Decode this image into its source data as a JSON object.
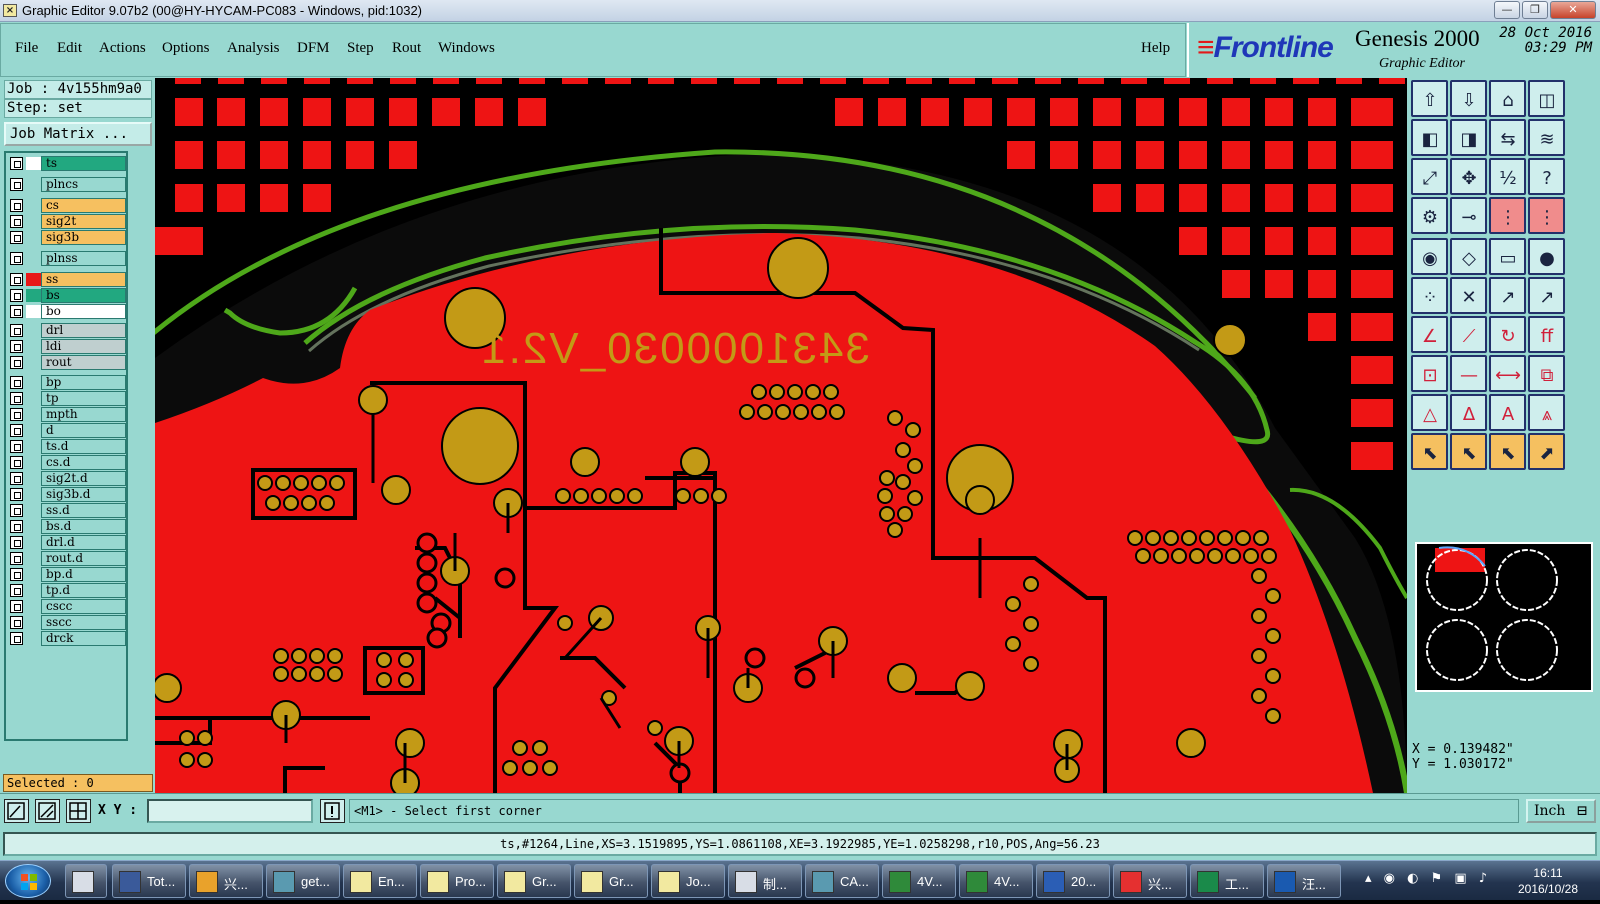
{
  "window": {
    "title": "Graphic Editor 9.07b2 (00@HY-HYCAM-PC083 - Windows, pid:1032)",
    "controls": [
      "—",
      "❐",
      "✕"
    ]
  },
  "menu": {
    "items": [
      "File",
      "Edit",
      "Actions",
      "Options",
      "Analysis",
      "DFM",
      "Step",
      "Rout",
      "Windows"
    ],
    "help": "Help"
  },
  "brand": {
    "logo": "Frontline",
    "product": "Genesis 2000",
    "subtitle": "Graphic Editor",
    "date": "28 Oct 2016",
    "time": "03:29 PM"
  },
  "job": {
    "job_line": "Job : 4v155hm9a0",
    "step_line": "Step: set",
    "matrix_button": "Job Matrix ..."
  },
  "layers": [
    {
      "name": "ts",
      "color": "#22a880",
      "swatch": "#ffffff"
    },
    {
      "name": "plncs",
      "color": "#98d8d0",
      "swatch": "#98d8d0"
    },
    {
      "name": "cs",
      "color": "#f6c060",
      "swatch": "#98d8d0"
    },
    {
      "name": "sig2t",
      "color": "#f6c060",
      "swatch": "#98d8d0"
    },
    {
      "name": "sig3b",
      "color": "#f6c060",
      "swatch": "#98d8d0"
    },
    {
      "name": "plnss",
      "color": "#98d8d0",
      "swatch": "#98d8d0"
    },
    {
      "name": "ss",
      "color": "#f6c060",
      "swatch": "#e81818"
    },
    {
      "name": "bs",
      "color": "#22a880",
      "swatch": "#22a880"
    },
    {
      "name": "bo",
      "color": "#ffffff",
      "swatch": "#ffffff"
    },
    {
      "name": "drl",
      "color": "#bfcfcf",
      "swatch": "#98d8d0"
    },
    {
      "name": "ldi",
      "color": "#bfcfcf",
      "swatch": "#98d8d0"
    },
    {
      "name": "rout",
      "color": "#bfcfcf",
      "swatch": "#98d8d0"
    },
    {
      "name": "bp",
      "color": "#98d8d0",
      "swatch": "#98d8d0"
    },
    {
      "name": "tp",
      "color": "#98d8d0",
      "swatch": "#98d8d0"
    },
    {
      "name": "mpth",
      "color": "#98d8d0",
      "swatch": "#98d8d0"
    },
    {
      "name": "d",
      "color": "#98d8d0",
      "swatch": "#98d8d0"
    },
    {
      "name": "ts.d",
      "color": "#98d8d0",
      "swatch": "#98d8d0"
    },
    {
      "name": "cs.d",
      "color": "#98d8d0",
      "swatch": "#98d8d0"
    },
    {
      "name": "sig2t.d",
      "color": "#98d8d0",
      "swatch": "#98d8d0"
    },
    {
      "name": "sig3b.d",
      "color": "#98d8d0",
      "swatch": "#98d8d0"
    },
    {
      "name": "ss.d",
      "color": "#98d8d0",
      "swatch": "#98d8d0"
    },
    {
      "name": "bs.d",
      "color": "#98d8d0",
      "swatch": "#98d8d0"
    },
    {
      "name": "drl.d",
      "color": "#98d8d0",
      "swatch": "#98d8d0"
    },
    {
      "name": "rout.d",
      "color": "#98d8d0",
      "swatch": "#98d8d0"
    },
    {
      "name": "bp.d",
      "color": "#98d8d0",
      "swatch": "#98d8d0"
    },
    {
      "name": "tp.d",
      "color": "#98d8d0",
      "swatch": "#98d8d0"
    },
    {
      "name": "cscc",
      "color": "#98d8d0",
      "swatch": "#98d8d0"
    },
    {
      "name": "sscc",
      "color": "#98d8d0",
      "swatch": "#98d8d0"
    },
    {
      "name": "drck",
      "color": "#98d8d0",
      "swatch": "#98d8d0"
    }
  ],
  "selected": "Selected : 0",
  "board": {
    "silkscreen_text": "3431000030_V2.1",
    "copper_color": "#ee1414",
    "pad_color": "#c39a16",
    "outline_color": "#4ea81a"
  },
  "coords": {
    "x": "X = 0.139482\"",
    "y": "Y = 1.030172\""
  },
  "command": {
    "xy_label": "X Y :",
    "xy_value": "",
    "prompt": "<M1> - Select first corner",
    "units": "Inch"
  },
  "status": "ts,#1264,Line,XS=3.1519895,YS=1.0861108,XE=3.1922985,YE=1.0258298,r10,POS,Ang=56.23",
  "taskbar": {
    "items": [
      "Tot...",
      "兴...",
      "get...",
      "En...",
      "Pro...",
      "Gr...",
      "Gr...",
      "Jo...",
      "制...",
      "CA...",
      "4V...",
      "4V...",
      "20...",
      "兴...",
      "工...",
      "汪..."
    ],
    "time": "16:11",
    "date": "2016/10/28"
  }
}
